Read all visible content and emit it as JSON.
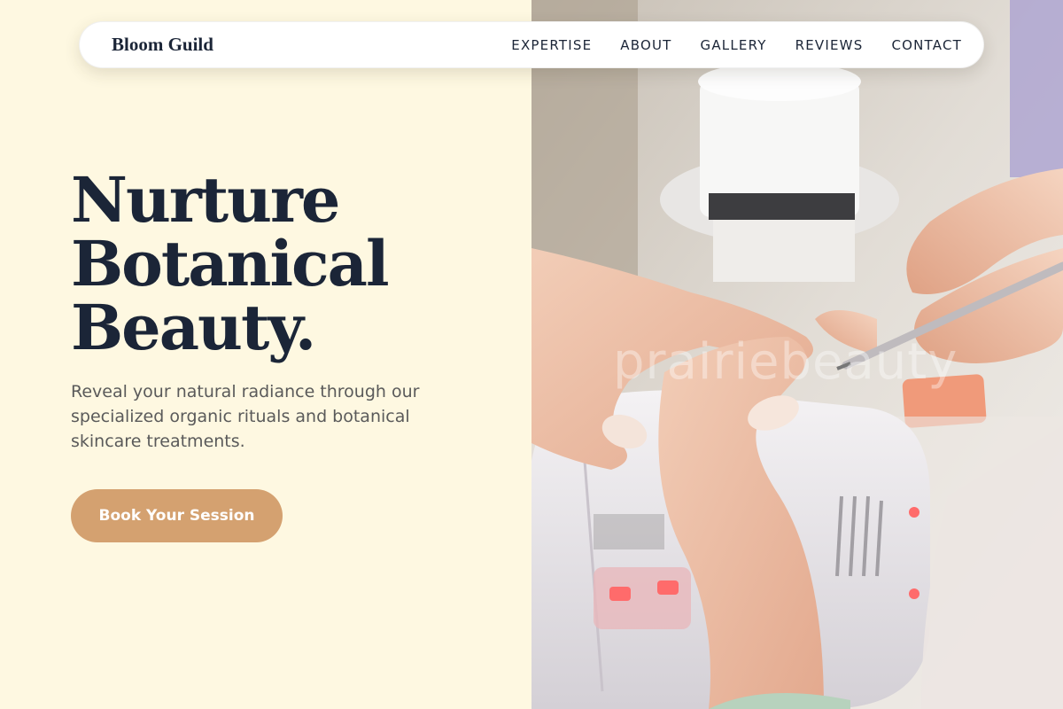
{
  "nav": {
    "brand": "Bloom Guild",
    "links": [
      {
        "label": "EXPERTISE"
      },
      {
        "label": "ABOUT"
      },
      {
        "label": "GALLERY"
      },
      {
        "label": "REVIEWS"
      },
      {
        "label": "CONTACT"
      }
    ]
  },
  "hero": {
    "title_lines": [
      "Nurture",
      "Botanical",
      "Beauty."
    ],
    "subtitle": "Reveal your natural radiance through our specialized organic rituals and botanical skincare treatments.",
    "cta_label": "Book Your Session"
  },
  "image": {
    "watermark": "prairiebeauty"
  },
  "colors": {
    "background": "#fef8e1",
    "ink": "#1b2537",
    "accent": "#d4a170"
  }
}
